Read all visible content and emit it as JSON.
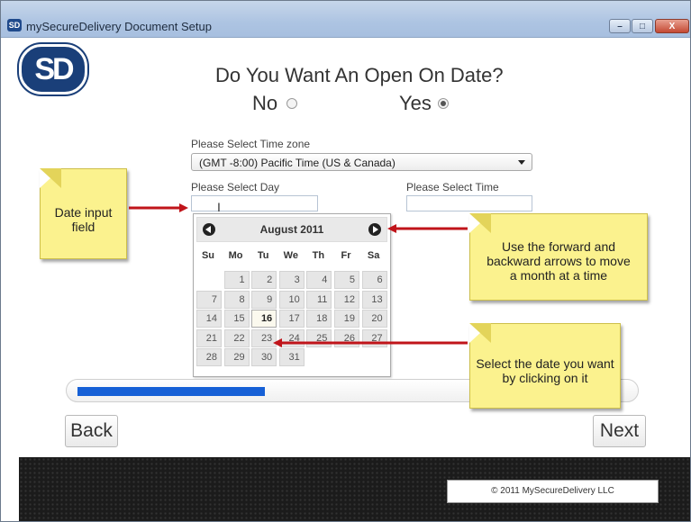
{
  "window": {
    "icon_text": "SD",
    "title": "mySecureDelivery Document Setup",
    "controls": {
      "minimize": "–",
      "maximize": "□",
      "close": "X"
    }
  },
  "logo_text": "SD",
  "question": "Do You Want An Open On Date?",
  "options": {
    "no": {
      "label": "No",
      "selected": false
    },
    "yes": {
      "label": "Yes",
      "selected": true
    }
  },
  "timezone": {
    "label": "Please Select Time zone",
    "value": "(GMT -8:00) Pacific Time (US & Canada)"
  },
  "day": {
    "label": "Please Select Day",
    "value": ""
  },
  "time": {
    "label": "Please Select Time",
    "value": ""
  },
  "calendar": {
    "title": "August 2011",
    "weekdays": [
      "Su",
      "Mo",
      "Tu",
      "We",
      "Th",
      "Fr",
      "Sa"
    ],
    "first_weekday_index": 1,
    "days_in_month": 31,
    "today": 16
  },
  "progress": {
    "percent": 34
  },
  "buttons": {
    "back": "Back",
    "next": "Next"
  },
  "footer": {
    "copyright": "© 2011 MySecureDelivery LLC"
  },
  "callouts": {
    "date_input": "Date input field",
    "arrows": "Use the forward and backward arrows to move a month at a time",
    "select_date": "Select the date you want by clicking on it"
  },
  "colors": {
    "callout_background": "#fbf28e",
    "arrow": "#c0141a",
    "progress_fill": "#1660d6",
    "logo": "#1a3f79"
  }
}
